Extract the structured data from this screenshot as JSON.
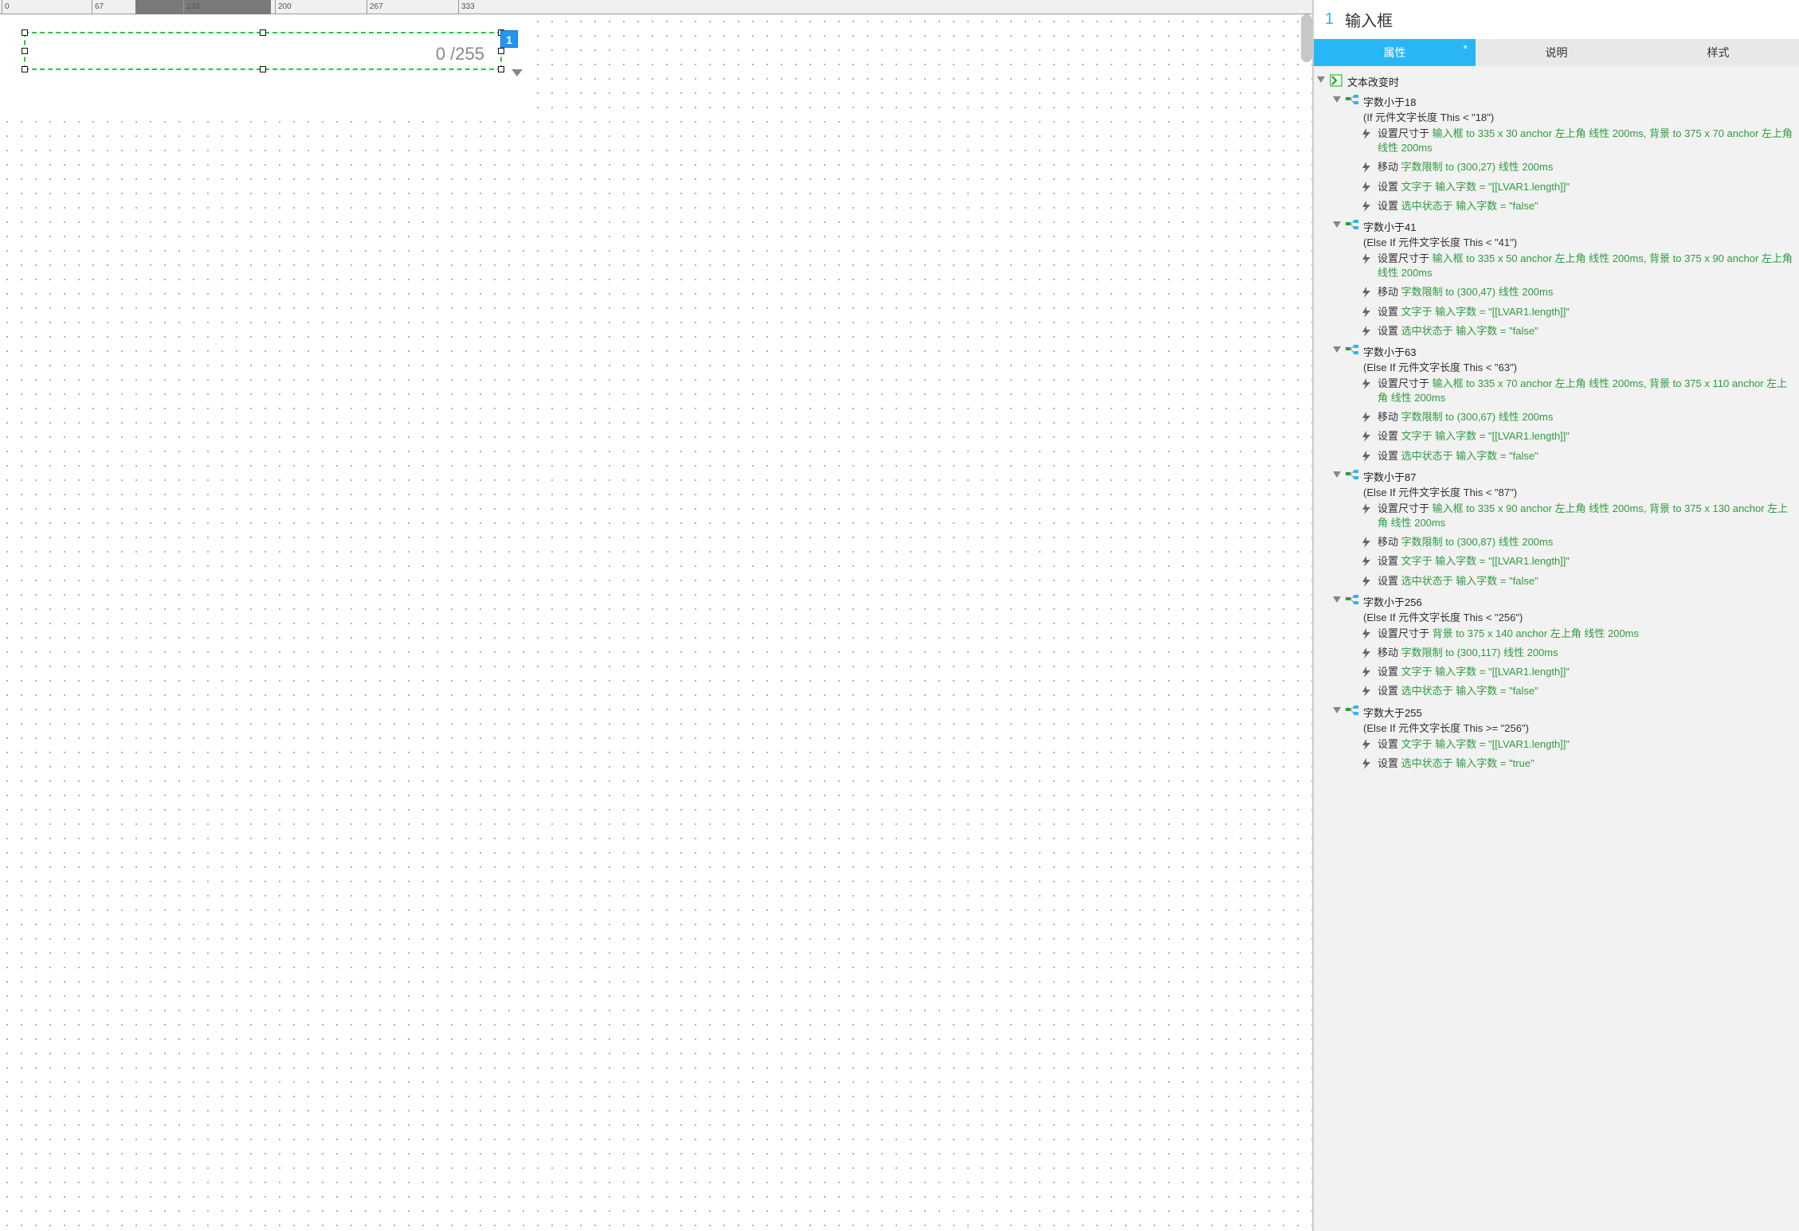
{
  "ruler": {
    "ticks": [
      "0",
      "67",
      "133",
      "200",
      "267",
      "333"
    ]
  },
  "canvas": {
    "badge": "1",
    "counter": "0 /255"
  },
  "inspector": {
    "index": "1",
    "title": "输入框",
    "tabs": {
      "properties": "属性",
      "dirty_mark": "*",
      "notes": "说明",
      "style": "样式"
    },
    "event_label": "文本改变时",
    "cases": [
      {
        "title": "字数小于18",
        "cond": "(If 元件文字长度 This < \"18\")",
        "actions": [
          {
            "label": "设置尺寸于 ",
            "green": "输入框 to 335 x 30 anchor 左上角 线性 200ms, 背景 to 375 x 70 anchor 左上角 线性 200ms"
          },
          {
            "label": "移动 ",
            "green": "字数限制 to (300,27) 线性 200ms"
          },
          {
            "label": "设置 ",
            "green": "文字于 输入字数 = \"[[LVAR1.length]]\""
          },
          {
            "label": "设置 ",
            "green": "选中状态于 输入字数 = \"false\""
          }
        ]
      },
      {
        "title": "字数小于41",
        "cond": "(Else If 元件文字长度 This < \"41\")",
        "actions": [
          {
            "label": "设置尺寸于 ",
            "green": "输入框 to 335 x 50 anchor 左上角 线性 200ms, 背景 to 375 x 90 anchor 左上角 线性 200ms"
          },
          {
            "label": "移动 ",
            "green": "字数限制 to (300,47) 线性 200ms"
          },
          {
            "label": "设置 ",
            "green": "文字于 输入字数 = \"[[LVAR1.length]]\""
          },
          {
            "label": "设置 ",
            "green": "选中状态于 输入字数 = \"false\""
          }
        ]
      },
      {
        "title": "字数小于63",
        "cond": "(Else If 元件文字长度 This < \"63\")",
        "actions": [
          {
            "label": "设置尺寸于 ",
            "green": "输入框 to 335 x 70 anchor 左上角 线性 200ms, 背景 to 375 x 110 anchor 左上角 线性 200ms"
          },
          {
            "label": "移动 ",
            "green": "字数限制 to (300,67) 线性 200ms"
          },
          {
            "label": "设置 ",
            "green": "文字于 输入字数 = \"[[LVAR1.length]]\""
          },
          {
            "label": "设置 ",
            "green": "选中状态于 输入字数 = \"false\""
          }
        ]
      },
      {
        "title": "字数小于87",
        "cond": "(Else If 元件文字长度 This < \"87\")",
        "actions": [
          {
            "label": "设置尺寸于 ",
            "green": "输入框 to 335 x 90 anchor 左上角 线性 200ms, 背景 to 375 x 130 anchor 左上角 线性 200ms"
          },
          {
            "label": "移动 ",
            "green": "字数限制 to (300,87) 线性 200ms"
          },
          {
            "label": "设置 ",
            "green": "文字于 输入字数 = \"[[LVAR1.length]]\""
          },
          {
            "label": "设置 ",
            "green": "选中状态于 输入字数 = \"false\""
          }
        ]
      },
      {
        "title": "字数小于256",
        "cond": "(Else If 元件文字长度 This < \"256\")",
        "actions": [
          {
            "label": "设置尺寸于 ",
            "green": "背景 to 375 x 140 anchor 左上角 线性 200ms"
          },
          {
            "label": "移动 ",
            "green": "字数限制 to (300,117) 线性 200ms"
          },
          {
            "label": "设置 ",
            "green": "文字于 输入字数 = \"[[LVAR1.length]]\""
          },
          {
            "label": "设置 ",
            "green": "选中状态于 输入字数 = \"false\""
          }
        ]
      },
      {
        "title": "字数大于255",
        "cond": "(Else If 元件文字长度 This >= \"256\")",
        "actions": [
          {
            "label": "设置 ",
            "green": "文字于 输入字数 = \"[[LVAR1.length]]\""
          },
          {
            "label": "设置 ",
            "green": "选中状态于 输入字数 = \"true\""
          }
        ]
      }
    ]
  }
}
